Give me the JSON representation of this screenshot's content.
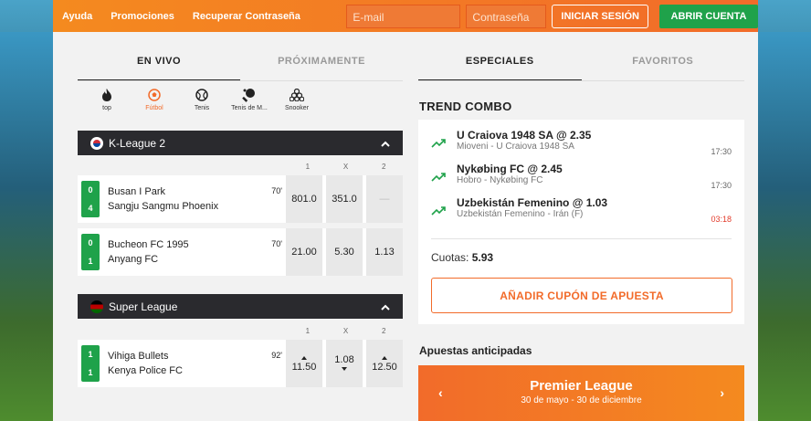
{
  "topbar": {
    "links": [
      "Ayuda",
      "Promociones",
      "Recuperar Contraseña"
    ],
    "email_placeholder": "E-mail",
    "password_placeholder": "Contraseña",
    "login_label": "INICIAR SESIÓN",
    "register_label": "ABRIR CUENTA"
  },
  "left_tabs": [
    "EN VIVO",
    "PRÓXIMAMENTE"
  ],
  "right_tabs": [
    "ESPECIALES",
    "FAVORITOS"
  ],
  "sports": [
    {
      "label": "top",
      "icon": "flame-icon"
    },
    {
      "label": "Fútbol",
      "icon": "soccer-ball-icon"
    },
    {
      "label": "Tenis",
      "icon": "tennis-ball-icon"
    },
    {
      "label": "Tenis de M...",
      "icon": "table-tennis-icon"
    },
    {
      "label": "Snooker",
      "icon": "snooker-icon"
    }
  ],
  "odds_headers": [
    "1",
    "X",
    "2"
  ],
  "leagues": [
    {
      "name": "K-League 2",
      "flag": "south-korea-flag-icon",
      "matches": [
        {
          "home": "Busan I Park",
          "away": "Sangju Sangmu Phoenix",
          "score_home": "0",
          "score_away": "4",
          "minute": "70'",
          "odds": [
            "801.0",
            "351.0",
            "—"
          ]
        },
        {
          "home": "Bucheon FC 1995",
          "away": "Anyang FC",
          "score_home": "0",
          "score_away": "1",
          "minute": "70'",
          "odds": [
            "21.00",
            "5.30",
            "1.13"
          ]
        }
      ]
    },
    {
      "name": "Super League",
      "flag": "kenya-flag-icon",
      "matches": [
        {
          "home": "Vihiga Bullets",
          "away": "Kenya Police FC",
          "score_home": "1",
          "score_away": "1",
          "minute": "92'",
          "odds": [
            "11.50",
            "1.08",
            "12.50"
          ]
        }
      ]
    }
  ],
  "trend": {
    "title": "TREND COMBO",
    "items": [
      {
        "pick": "U Craiova 1948 SA @ 2.35",
        "event": "Mioveni - U Craiova 1948 SA",
        "time": "17:30"
      },
      {
        "pick": "Nykøbing FC @ 2.45",
        "event": "Hobro - Nykøbing FC",
        "time": "17:30"
      },
      {
        "pick": "Uzbekistán Femenino @ 1.03",
        "event": "Uzbekistán Femenino - Irán (F)",
        "time": "03:18"
      }
    ],
    "odds_label": "Cuotas:",
    "odds_value": "5.93",
    "add_button": "AÑADIR CUPÓN DE APUESTA"
  },
  "ante_post": {
    "title": "Apuestas anticipadas",
    "league": "Premier League",
    "dates": "30 de mayo - 30 de diciembre"
  },
  "colors": {
    "brand_orange": "#f26b2a",
    "green": "#1fa24a",
    "dark_header": "#2a2a2e",
    "alert_red": "#e23b2b"
  }
}
